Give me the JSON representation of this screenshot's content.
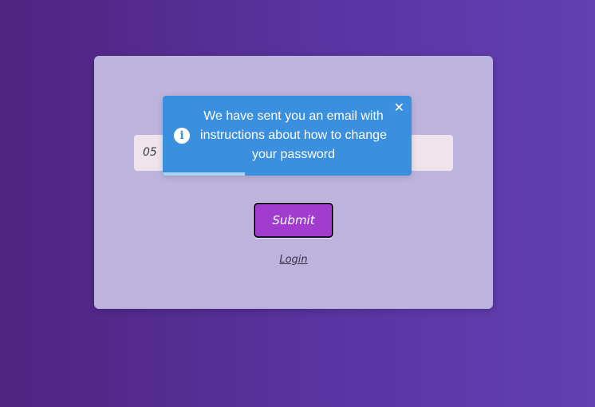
{
  "form": {
    "input_value": "05",
    "submit_label": "Submit",
    "login_label": "Login"
  },
  "toast": {
    "message": "We have sent you an email with instructions about how to change your password",
    "icon": "info-icon",
    "close_glyph": "✕",
    "progress_fraction": 0.33
  },
  "colors": {
    "toast_background": "#3a8fde",
    "submit_background": "#a23ccf",
    "card_background": "#bdb4dd"
  }
}
